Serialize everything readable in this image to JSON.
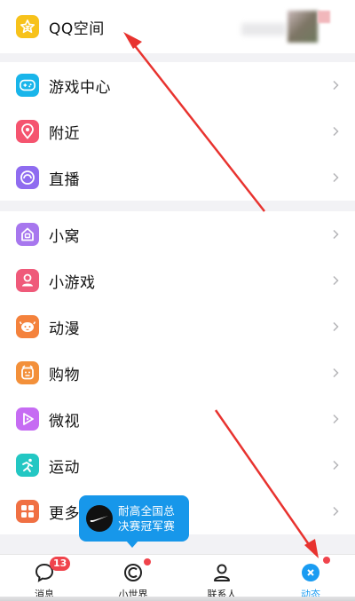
{
  "qzone": {
    "label": "QQ空间",
    "icon": "qzone-star-icon",
    "color": "#f7c21b"
  },
  "group1": [
    {
      "key": "games",
      "label": "游戏中心",
      "icon": "gamepad-icon",
      "color": "#19b5ea"
    },
    {
      "key": "nearby",
      "label": "附近",
      "icon": "location-pin-icon",
      "color": "#f5546f"
    },
    {
      "key": "live",
      "label": "直播",
      "icon": "live-icon",
      "color": "#8f6cf0"
    }
  ],
  "group2": [
    {
      "key": "xiaowo",
      "label": "小窝",
      "icon": "house-icon",
      "color": "#a777ee"
    },
    {
      "key": "minigames",
      "label": "小游戏",
      "icon": "minigame-icon",
      "color": "#ef5a7a"
    },
    {
      "key": "anime",
      "label": "动漫",
      "icon": "anime-face-icon",
      "color": "#f4823c"
    },
    {
      "key": "shopping",
      "label": "购物",
      "icon": "shopping-icon",
      "color": "#f3903a"
    },
    {
      "key": "weishi",
      "label": "微视",
      "icon": "play-icon",
      "color": "#c66cf3"
    },
    {
      "key": "sports",
      "label": "运动",
      "icon": "running-icon",
      "color": "#23c7c3"
    },
    {
      "key": "more",
      "label": "更多",
      "icon": "grid-icon",
      "color": "#f07043"
    }
  ],
  "bubble": {
    "line1": "耐高全国总",
    "line2": "决赛冠军赛",
    "icon": "nike-swoosh-icon",
    "color": "#1797ea"
  },
  "tabs": [
    {
      "key": "messages",
      "label": "消息",
      "icon": "chat-bubble-icon",
      "badge": "13"
    },
    {
      "key": "small-world",
      "label": "小世界",
      "icon": "small-world-icon"
    },
    {
      "key": "contacts",
      "label": "联系人",
      "icon": "person-icon"
    },
    {
      "key": "feed",
      "label": "动态",
      "icon": "star-circle-icon",
      "active": true
    }
  ],
  "colors": {
    "accent": "#1a9cf2",
    "badge": "#f0444c",
    "annotation_arrow": "#e8332f"
  }
}
